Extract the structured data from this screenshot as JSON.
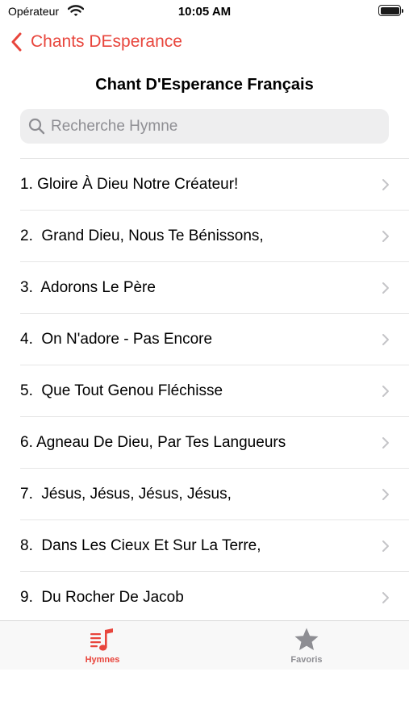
{
  "status_bar": {
    "carrier": "Opérateur",
    "time": "10:05 AM",
    "battery": 1.0
  },
  "nav": {
    "back_label": "Chants DEsperance"
  },
  "header": {
    "title": "Chant D'Esperance Français"
  },
  "search": {
    "value": "",
    "placeholder": "Recherche Hymne"
  },
  "hymns": [
    "1. Gloire À Dieu Notre Créateur!",
    "2.  Grand Dieu, Nous Te Bénissons,",
    "3.  Adorons Le Père",
    "4.  On N'adore - Pas Encore",
    "5.  Que Tout Genou Fléchisse",
    "6. Agneau De Dieu, Par Tes Langueurs",
    "7.  Jésus, Jésus, Jésus, Jésus,",
    "8.  Dans Les Cieux Et Sur La Terre,",
    "9.  Du Rocher De Jacob"
  ],
  "tabs": [
    {
      "label": "Hymnes",
      "icon": "music-list-icon",
      "selected": true
    },
    {
      "label": "Favoris",
      "icon": "star-icon",
      "selected": false
    }
  ],
  "colors": {
    "accent": "#e8453c",
    "inactive": "#8e8e93",
    "chevron": "#c4c4c7"
  }
}
